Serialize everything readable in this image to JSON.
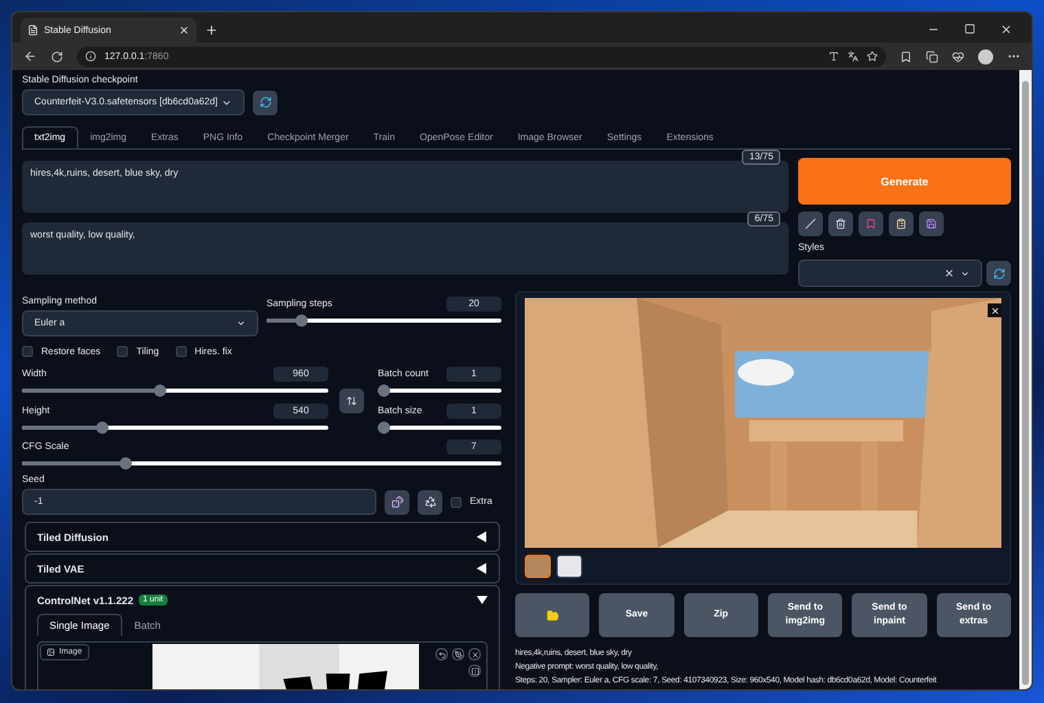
{
  "browser": {
    "tab_title": "Stable Diffusion",
    "url_host": "127.0.0.1",
    "url_port": ":7860"
  },
  "checkpoint": {
    "label": "Stable Diffusion checkpoint",
    "value": "Counterfeit-V3.0.safetensors [db6cd0a62d]"
  },
  "tabs": [
    {
      "label": "txt2img",
      "selected": true
    },
    {
      "label": "img2img",
      "selected": false
    },
    {
      "label": "Extras",
      "selected": false
    },
    {
      "label": "PNG Info",
      "selected": false
    },
    {
      "label": "Checkpoint Merger",
      "selected": false
    },
    {
      "label": "Train",
      "selected": false
    },
    {
      "label": "OpenPose Editor",
      "selected": false
    },
    {
      "label": "Image Browser",
      "selected": false
    },
    {
      "label": "Settings",
      "selected": false
    },
    {
      "label": "Extensions",
      "selected": false
    }
  ],
  "prompt": {
    "value": "hires,4k,ruins, desert, blue sky, dry",
    "token_count": "13/75"
  },
  "negative_prompt": {
    "value": "worst quality, low quality,",
    "token_count": "6/75"
  },
  "generate_button": "Generate",
  "styles": {
    "label": "Styles"
  },
  "sampling_method": {
    "label": "Sampling method",
    "value": "Euler a"
  },
  "sampling_steps": {
    "label": "Sampling steps",
    "value": "20",
    "level": 0.13
  },
  "checkboxes": [
    {
      "label": "Restore faces",
      "checked": false
    },
    {
      "label": "Tiling",
      "checked": false
    },
    {
      "label": "Hires. fix",
      "checked": false
    }
  ],
  "width": {
    "label": "Width",
    "value": "960",
    "level": 0.45
  },
  "height": {
    "label": "Height",
    "value": "540",
    "level": 0.25
  },
  "batch_count": {
    "label": "Batch count",
    "value": "1",
    "level": 0
  },
  "batch_size": {
    "label": "Batch size",
    "value": "1",
    "level": 0
  },
  "cfg_scale": {
    "label": "CFG Scale",
    "value": "7",
    "level": 0.21
  },
  "seed": {
    "label": "Seed",
    "value": "-1",
    "extra_label": "Extra",
    "extra_checked": false
  },
  "accordions": [
    {
      "title": "Tiled Diffusion",
      "expanded": false
    },
    {
      "title": "Tiled VAE",
      "expanded": false
    },
    {
      "title": "ControlNet v1.1.222",
      "badge": "1 unit",
      "expanded": true
    }
  ],
  "controlnet": {
    "tabs": [
      {
        "label": "Single Image",
        "selected": true
      },
      {
        "label": "Batch",
        "selected": false
      }
    ],
    "image_label": "Image"
  },
  "gallery": {
    "thumbnails": [
      {
        "selected": true
      },
      {
        "selected": false
      }
    ]
  },
  "actions": [
    {
      "kind": "icon"
    },
    {
      "kind": "text",
      "label": "Save"
    },
    {
      "kind": "text",
      "label": "Zip"
    },
    {
      "kind": "text",
      "label": "Send to img2img"
    },
    {
      "kind": "text",
      "label": "Send to inpaint"
    },
    {
      "kind": "text",
      "label": "Send to extras"
    }
  ],
  "info": [
    "hires,4k,ruins, desert, blue sky, dry",
    "Negative prompt: worst quality, low quality,",
    "Steps: 20, Sampler: Euler a, CFG scale: 7, Seed: 4107340923, Size: 960x540, Model hash: db6cd0a62d, Model: Counterfeit"
  ]
}
